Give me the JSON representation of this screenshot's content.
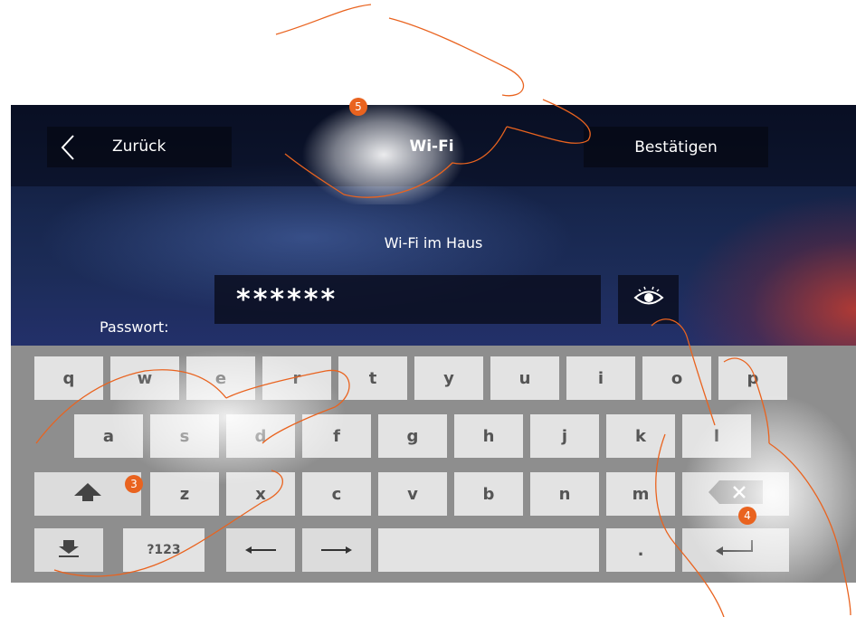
{
  "header": {
    "back_label": "Zurück",
    "title": "Wi-Fi",
    "confirm_label": "Bestätigen"
  },
  "network_name": "Wi-Fi im Haus",
  "password": {
    "label": "Passwort:",
    "value": "******"
  },
  "keyboard": {
    "row1": [
      "q",
      "w",
      "e",
      "r",
      "t",
      "y",
      "u",
      "i",
      "o",
      "p"
    ],
    "row2": [
      "a",
      "s",
      "d",
      "f",
      "g",
      "h",
      "j",
      "k",
      "l"
    ],
    "row3": [
      "z",
      "x",
      "c",
      "v",
      "b",
      "n",
      "m"
    ],
    "symbols_label": "?123",
    "period_label": "."
  },
  "markers": [
    "3",
    "4",
    "5"
  ],
  "icons": [
    "back-chevron-icon",
    "eye-icon",
    "shift-arrow-icon",
    "keyboard-hide-icon",
    "arrow-left-icon",
    "arrow-right-icon",
    "backspace-icon",
    "enter-icon"
  ],
  "colors": {
    "marker": "#e9631f",
    "keyboard_bg": "#8e8e8e",
    "key_bg": "#e3e3e3"
  }
}
